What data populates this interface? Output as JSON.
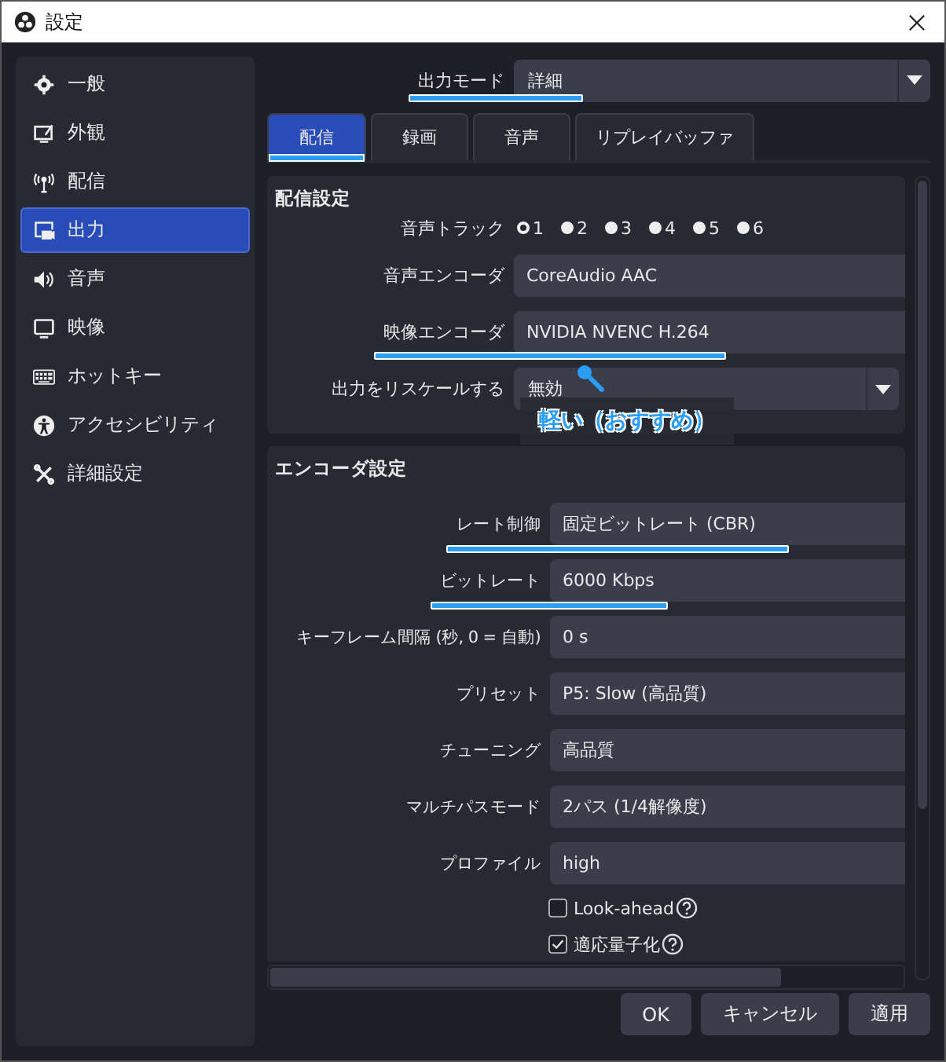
{
  "window": {
    "title": "設定"
  },
  "sidebar": {
    "items": [
      {
        "label": "一般",
        "selected": false
      },
      {
        "label": "外観",
        "selected": false
      },
      {
        "label": "配信",
        "selected": false
      },
      {
        "label": "出力",
        "selected": true
      },
      {
        "label": "音声",
        "selected": false
      },
      {
        "label": "映像",
        "selected": false
      },
      {
        "label": "ホットキー",
        "selected": false
      },
      {
        "label": "アクセシビリティ",
        "selected": false
      },
      {
        "label": "詳細設定",
        "selected": false
      }
    ]
  },
  "output_mode": {
    "label": "出力モード",
    "value": "詳細",
    "underlined": true
  },
  "tabs": [
    {
      "label": "配信",
      "selected": true,
      "underlined": true
    },
    {
      "label": "録画",
      "selected": false,
      "underlined": false
    },
    {
      "label": "音声",
      "selected": false,
      "underlined": false
    },
    {
      "label": "リプレイバッファ",
      "selected": false,
      "underlined": false
    }
  ],
  "stream_settings": {
    "title": "配信設定",
    "audio_track": {
      "label": "音声トラック",
      "options": [
        {
          "label": "1",
          "selected": true
        },
        {
          "label": "2",
          "selected": false
        },
        {
          "label": "3",
          "selected": false
        },
        {
          "label": "4",
          "selected": false
        },
        {
          "label": "5",
          "selected": false
        },
        {
          "label": "6",
          "selected": false
        }
      ]
    },
    "rows": [
      {
        "kind": "text",
        "label": "音声エンコーダ",
        "value": "CoreAudio AAC",
        "underlined": false
      },
      {
        "kind": "text",
        "label": "映像エンコーダ",
        "value": "NVIDIA NVENC H.264",
        "underlined": true
      },
      {
        "kind": "select",
        "label": "出力をリスケールする",
        "value": "無効",
        "underlined": false
      }
    ]
  },
  "callout": {
    "text": "軽い（おすすめ）"
  },
  "encoder_settings": {
    "title": "エンコーダ設定",
    "rows": [
      {
        "kind": "text",
        "label": "レート制御",
        "value": "固定ビットレート (CBR)",
        "underlined": true
      },
      {
        "kind": "text",
        "label": "ビットレート",
        "value": "6000 Kbps",
        "underlined": true
      },
      {
        "kind": "text",
        "label": "キーフレーム間隔 (秒, 0 = 自動)",
        "value": "0 s",
        "underlined": false
      },
      {
        "kind": "text",
        "label": "プリセット",
        "value": "P5: Slow (高品質)",
        "underlined": false
      },
      {
        "kind": "text",
        "label": "チューニング",
        "value": "高品質",
        "underlined": false
      },
      {
        "kind": "text",
        "label": "マルチパスモード",
        "value": "2パス (1/4解像度)",
        "underlined": false
      },
      {
        "kind": "text",
        "label": "プロファイル",
        "value": "high",
        "underlined": false
      }
    ],
    "checkboxes": [
      {
        "label": "Look-ahead",
        "checked": false
      },
      {
        "label": "適応量子化",
        "checked": true
      }
    ]
  },
  "buttons": [
    "OK",
    "キャンセル",
    "適用"
  ]
}
